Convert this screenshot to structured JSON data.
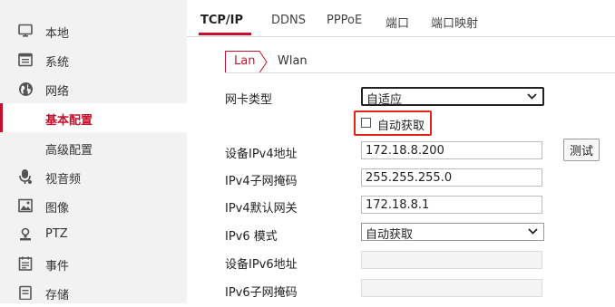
{
  "sidebar": {
    "items": [
      {
        "label": "本地",
        "icon": "monitor-icon"
      },
      {
        "label": "系统",
        "icon": "system-window-icon"
      },
      {
        "label": "网络",
        "icon": "globe-icon"
      },
      {
        "label": "基本配置",
        "active": true
      },
      {
        "label": "高级配置"
      },
      {
        "label": "视音频",
        "icon": "microphone-icon"
      },
      {
        "label": "图像",
        "icon": "image-icon"
      },
      {
        "label": "PTZ",
        "icon": "ptz-person-icon"
      },
      {
        "label": "事件",
        "icon": "event-list-icon"
      },
      {
        "label": "存储",
        "icon": "storage-icon"
      }
    ]
  },
  "tabs": [
    {
      "label": "TCP/IP",
      "active": true
    },
    {
      "label": "DDNS"
    },
    {
      "label": "PPPoE"
    },
    {
      "label": "端口"
    },
    {
      "label": "端口映射"
    }
  ],
  "subtabs": [
    {
      "label": "Lan",
      "active": true
    },
    {
      "label": "Wlan"
    }
  ],
  "form": {
    "nic_type": {
      "label": "网卡类型",
      "value": "自适应"
    },
    "auto_obtain": {
      "label": "自动获取",
      "checked": false
    },
    "ipv4_address": {
      "label": "设备IPv4地址",
      "value": "172.18.8.200"
    },
    "test_button": "测试",
    "ipv4_mask": {
      "label": "IPv4子网掩码",
      "value": "255.255.255.0"
    },
    "ipv4_gateway": {
      "label": "IPv4默认网关",
      "value": "172.18.8.1"
    },
    "ipv6_mode": {
      "label": "IPv6 模式",
      "value": "自动获取"
    },
    "ipv6_address": {
      "label": "设备IPv6地址",
      "value": ""
    },
    "ipv6_mask": {
      "label": "IPv6子网掩码",
      "value": ""
    }
  },
  "colors": {
    "accent": "#c8102e",
    "highlight_box": "#e0261a",
    "sidebar_bg": "#f2f2f2"
  }
}
